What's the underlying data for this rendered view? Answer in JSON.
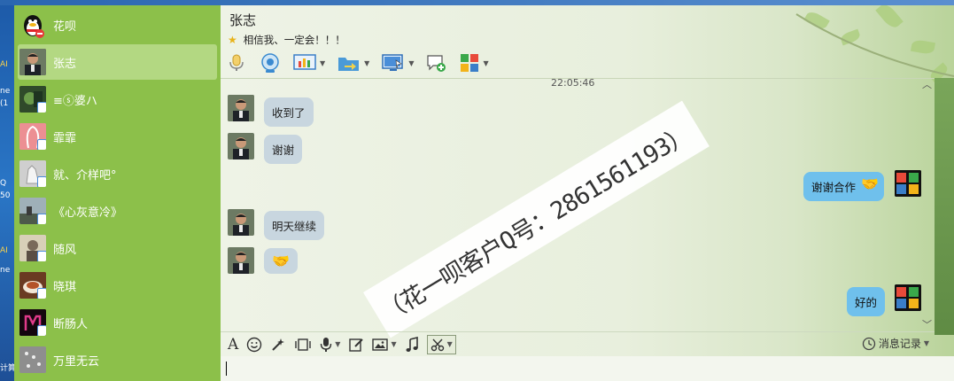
{
  "chat": {
    "title": "张志",
    "signature": "相信我、一定会！！！",
    "timestamp": "22:05:46",
    "watermark": "（花一呗客户Q号：2861561193）"
  },
  "contacts": [
    {
      "name": "花呗"
    },
    {
      "name": "张志"
    },
    {
      "name": "≡ⓢ婆ハ"
    },
    {
      "name": "霏霏"
    },
    {
      "name": "就、介样吧°"
    },
    {
      "name": "《心灰意冷》"
    },
    {
      "name": "随风"
    },
    {
      "name": "晓琪"
    },
    {
      "name": "断肠人"
    },
    {
      "name": "万里无云"
    }
  ],
  "messages": [
    {
      "from": "them",
      "text": "收到了"
    },
    {
      "from": "them",
      "text": "谢谢"
    },
    {
      "from": "me",
      "text": "谢谢合作"
    },
    {
      "from": "them",
      "text": "明天继续"
    },
    {
      "from": "them",
      "text": ""
    },
    {
      "from": "me",
      "text": "好的"
    }
  ],
  "input_toolbar": {
    "history_label": "消息记录"
  },
  "desktop": {
    "fragments": [
      "ne",
      "(1",
      "Q",
      "50",
      "AI",
      "ne",
      "AI",
      "计算"
    ]
  },
  "colors": {
    "sidebar": "#8cc04a",
    "active_contact": "#b3d882",
    "bubble_them": "#c8d6df",
    "bubble_me": "#6fc0ec"
  }
}
